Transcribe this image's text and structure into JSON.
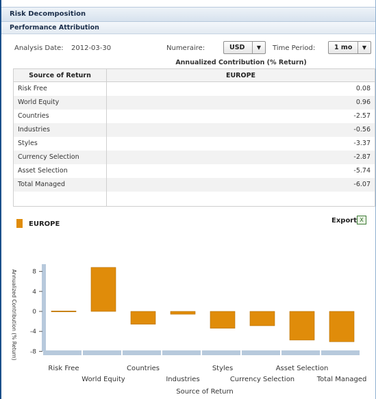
{
  "header": {
    "title": "Risk Decomposition",
    "subtitle": "Performance Attribution"
  },
  "controls": {
    "analysis_date_label": "Analysis Date:",
    "analysis_date_value": "2012-03-30",
    "numeraire_label": "Numeraire:",
    "numeraire_value": "USD",
    "time_period_label": "Time Period:",
    "time_period_value": "1 mo"
  },
  "table": {
    "group_title": "Annualized Contribution (% Return)",
    "columns": [
      "Source of Return",
      "EUROPE"
    ],
    "rows": [
      {
        "source": "Risk Free",
        "value": "0.08"
      },
      {
        "source": "World Equity",
        "value": "0.96"
      },
      {
        "source": "Countries",
        "value": "-2.57"
      },
      {
        "source": "Industries",
        "value": "-0.56"
      },
      {
        "source": "Styles",
        "value": "-3.37"
      },
      {
        "source": "Currency Selection",
        "value": "-2.87"
      },
      {
        "source": "Asset Selection",
        "value": "-5.74"
      },
      {
        "source": "Total Managed",
        "value": "-6.07"
      }
    ]
  },
  "chart_section": {
    "legend_label": "EUROPE",
    "export_label": "Export",
    "export_icon": "excel-icon"
  },
  "colors": {
    "bar": "#e08c0a",
    "axis": "#b7c9dc"
  },
  "chart_data": {
    "type": "bar",
    "categories": [
      "Risk Free",
      "World Equity",
      "Countries",
      "Industries",
      "Styles",
      "Currency Selection",
      "Asset Selection",
      "Total Managed"
    ],
    "series": [
      {
        "name": "EUROPE",
        "values": [
          0.08,
          8.8,
          -2.57,
          -0.56,
          -3.37,
          -2.87,
          -5.74,
          -6.07
        ]
      }
    ],
    "xlabel": "Source of Return",
    "ylabel": "Annualized Contribution (% Return)",
    "yticks": [
      "8",
      "4",
      "0",
      "-4",
      "-8"
    ],
    "ylim": [
      -8,
      10
    ],
    "grid": false,
    "legend": "top-left"
  }
}
